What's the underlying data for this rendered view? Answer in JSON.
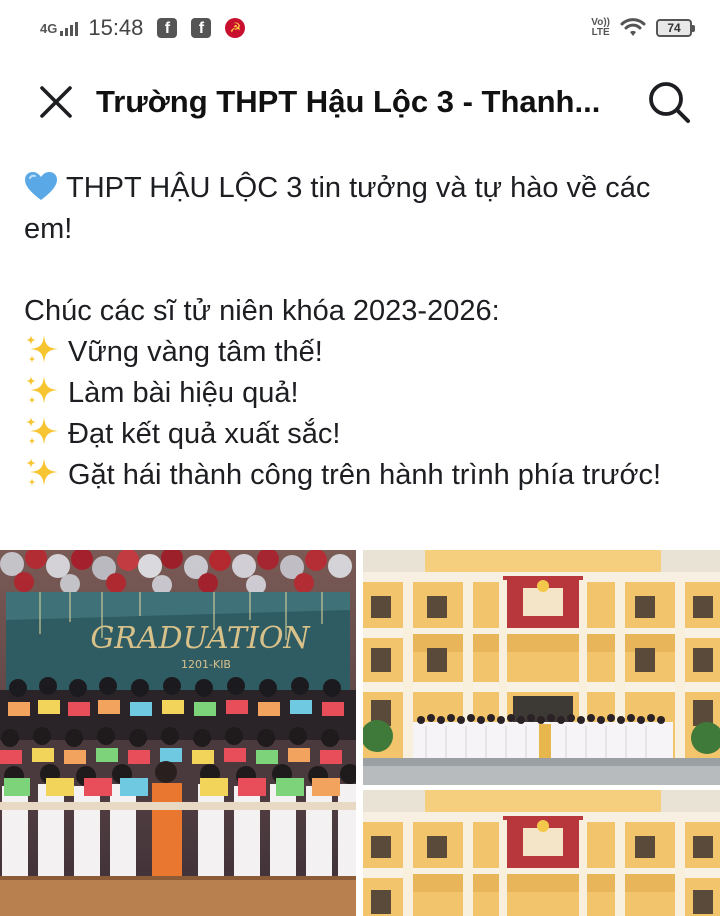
{
  "status_bar": {
    "network": "4G",
    "time": "15:48",
    "battery": "74",
    "volte_top": "Vo))",
    "volte_bottom": "LTE"
  },
  "header": {
    "title": "Trường THPT Hậu Lộc 3 - Thanh..."
  },
  "post": {
    "line1": "THPT HẬU LỘC 3 tin tưởng và tự hào về các em!",
    "line2": "Chúc các sĩ tử niên khóa 2023-2026:",
    "wishes": [
      "Vững vàng tâm thế!",
      "Làm bài hiệu quả!",
      "Đạt kết quả xuất sắc!",
      "Gặt hái thành công trên hành trình phía trước!"
    ]
  },
  "photos": {
    "banner_text": "GRADUATION",
    "banner_sub": "1201-KIB"
  },
  "colors": {
    "text": "#1c1e21",
    "heart": "#5aa9e6",
    "sparkle": "#f7c531",
    "building_wall": "#f2c46b",
    "building_red": "#b8373c"
  },
  "icons": {
    "close": "close-icon",
    "search": "search-icon",
    "heart": "blue-heart-emoji",
    "sparkles": "sparkles-emoji"
  }
}
